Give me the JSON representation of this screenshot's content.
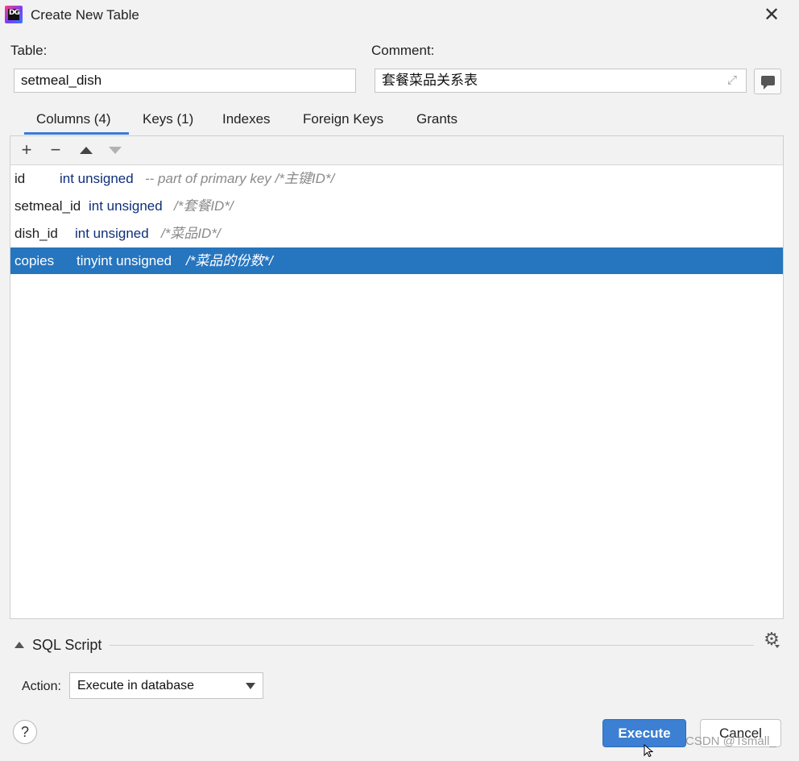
{
  "window": {
    "title": "Create New Table"
  },
  "table_label": "Table:",
  "table_value": "setmeal_dish",
  "comment_label": "Comment:",
  "comment_value": "套餐菜品关系表",
  "tabs": [
    {
      "label": "Columns (4)",
      "active": true
    },
    {
      "label": "Keys (1)"
    },
    {
      "label": "Indexes"
    },
    {
      "label": "Foreign Keys"
    },
    {
      "label": "Grants"
    }
  ],
  "toolbar": {
    "add": "+",
    "remove": "−"
  },
  "columns": [
    {
      "name": "id",
      "type": "int unsigned",
      "comment": "-- part of primary key /*主键ID*/"
    },
    {
      "name": "setmeal_id",
      "type": "int unsigned",
      "comment": "/*套餐ID*/"
    },
    {
      "name": "dish_id",
      "type": "int unsigned",
      "comment": "/*菜品ID*/"
    },
    {
      "name": "copies",
      "type": "tinyint unsigned",
      "comment": "/*菜品的份数*/",
      "selected": true
    }
  ],
  "sql_script": {
    "label": "SQL Script"
  },
  "action": {
    "label": "Action:",
    "value": "Execute in database"
  },
  "buttons": {
    "help": "?",
    "execute": "Execute",
    "cancel": "Cancel"
  },
  "watermark": "CSDN @Tsmall_",
  "colors": {
    "accent": "#3c7fd3",
    "selection": "#2675bf",
    "type_text": "#0e2f7a"
  }
}
